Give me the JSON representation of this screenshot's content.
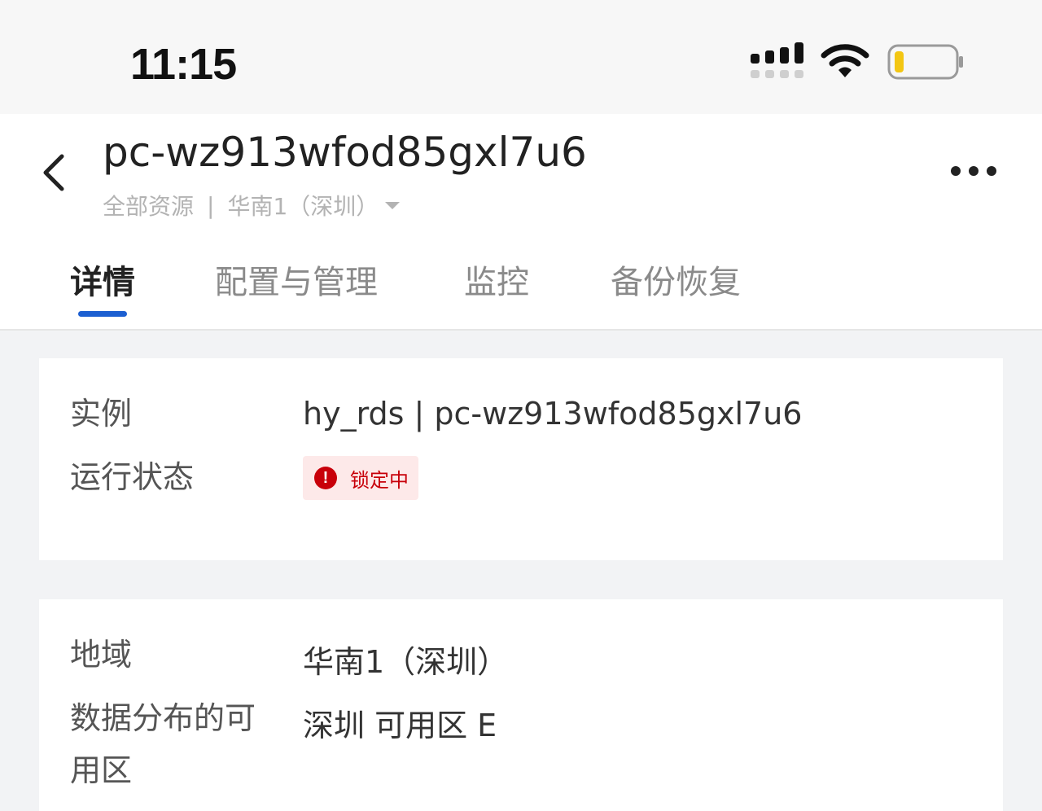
{
  "status_bar": {
    "time": "11:15",
    "icons": [
      "cellular-signal-icon",
      "wifi-icon",
      "battery-low-icon"
    ]
  },
  "header": {
    "title": "pc-wz913wfod85gxl7u6",
    "breadcrumb": {
      "root": "全部资源",
      "separator": "|",
      "region": "华南1（深圳）"
    },
    "back_icon": "chevron-left-icon",
    "more_icon": "more-horizontal-icon"
  },
  "tabs": [
    {
      "label": "详情",
      "active": true
    },
    {
      "label": "配置与管理",
      "active": false
    },
    {
      "label": "监控",
      "active": false
    },
    {
      "label": "备份恢复",
      "active": false
    }
  ],
  "instance_card": {
    "instance_label": "实例",
    "instance_value": "hy_rds | pc-wz913wfod85gxl7u6",
    "status_label": "运行状态",
    "status_value": "锁定中",
    "status_color": "#c8000a",
    "status_icon": "alert-circle-icon"
  },
  "region_card": {
    "region_label": "地域",
    "region_value": "华南1（深圳）",
    "zone_label": "数据分布的可用区",
    "zone_value": "深圳 可用区 E"
  },
  "colors": {
    "accent": "#1c5fd1",
    "background": "#f2f3f5"
  }
}
